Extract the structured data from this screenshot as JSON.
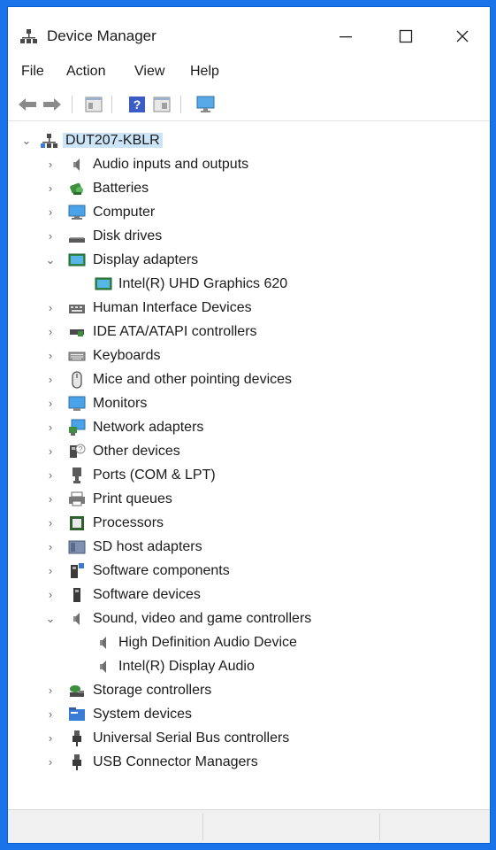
{
  "window": {
    "title": "Device Manager"
  },
  "menu": [
    "File",
    "Action",
    "View",
    "Help"
  ],
  "toolbar": {
    "buttons": [
      "back-arrow-icon",
      "forward-arrow-icon",
      "properties-icon",
      "help-icon",
      "update-driver-icon",
      "scan-hardware-icon"
    ]
  },
  "tree": {
    "root": "DUT207-KBLR",
    "items": [
      {
        "label": "Audio inputs and outputs",
        "icon": "speaker-icon",
        "expanded": false
      },
      {
        "label": "Batteries",
        "icon": "battery-icon",
        "expanded": false
      },
      {
        "label": "Computer",
        "icon": "computer-icon",
        "expanded": false
      },
      {
        "label": "Disk drives",
        "icon": "disk-drive-icon",
        "expanded": false
      },
      {
        "label": "Display adapters",
        "icon": "display-adapter-icon",
        "expanded": true,
        "children": [
          {
            "label": "Intel(R) UHD Graphics 620",
            "icon": "display-adapter-icon"
          }
        ]
      },
      {
        "label": "Human Interface Devices",
        "icon": "hid-icon",
        "expanded": false
      },
      {
        "label": "IDE ATA/ATAPI controllers",
        "icon": "ide-controller-icon",
        "expanded": false
      },
      {
        "label": "Keyboards",
        "icon": "keyboard-icon",
        "expanded": false
      },
      {
        "label": "Mice and other pointing devices",
        "icon": "mouse-icon",
        "expanded": false
      },
      {
        "label": "Monitors",
        "icon": "monitor-icon",
        "expanded": false
      },
      {
        "label": "Network adapters",
        "icon": "network-adapter-icon",
        "expanded": false
      },
      {
        "label": "Other devices",
        "icon": "unknown-device-icon",
        "expanded": false
      },
      {
        "label": "Ports (COM & LPT)",
        "icon": "port-icon",
        "expanded": false
      },
      {
        "label": "Print queues",
        "icon": "printer-icon",
        "expanded": false
      },
      {
        "label": "Processors",
        "icon": "processor-icon",
        "expanded": false
      },
      {
        "label": "SD host adapters",
        "icon": "sd-adapter-icon",
        "expanded": false
      },
      {
        "label": "Software components",
        "icon": "software-component-icon",
        "expanded": false
      },
      {
        "label": "Software devices",
        "icon": "software-device-icon",
        "expanded": false
      },
      {
        "label": "Sound, video and game controllers",
        "icon": "speaker-icon",
        "expanded": true,
        "children": [
          {
            "label": "High Definition Audio Device",
            "icon": "speaker-icon"
          },
          {
            "label": "Intel(R) Display Audio",
            "icon": "speaker-icon"
          }
        ]
      },
      {
        "label": "Storage controllers",
        "icon": "storage-controller-icon",
        "expanded": false
      },
      {
        "label": "System devices",
        "icon": "system-devices-icon",
        "expanded": false
      },
      {
        "label": "Universal Serial Bus controllers",
        "icon": "usb-icon",
        "expanded": false
      },
      {
        "label": "USB Connector Managers",
        "icon": "usb-icon",
        "expanded": false
      }
    ]
  },
  "colors": {
    "accent": "#1a73e8",
    "selection": "#cce4f7"
  }
}
